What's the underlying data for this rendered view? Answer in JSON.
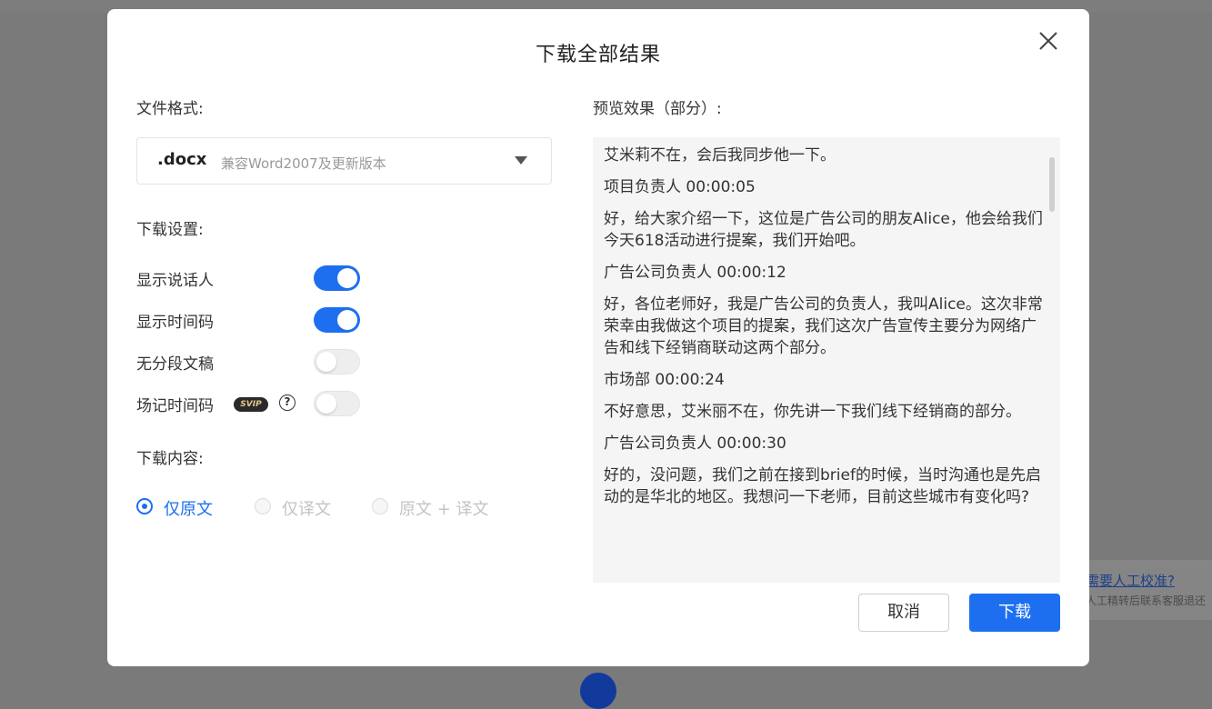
{
  "background": {
    "hint_title": "需要人工校准?",
    "hint_subtitle": "人工精转后联系客服退还"
  },
  "modal": {
    "title": "下载全部结果",
    "file_format_label": "文件格式:",
    "format_select": {
      "value": ".docx",
      "description": "兼容Word2007及更新版本"
    },
    "download_settings_label": "下载设置:",
    "toggles": [
      {
        "label": "显示说话人",
        "on": true
      },
      {
        "label": "显示时间码",
        "on": true
      },
      {
        "label": "无分段文稿",
        "on": false
      },
      {
        "label": "场记时间码",
        "on": false
      }
    ],
    "svip_badge": "SVIP",
    "help_icon": "?",
    "download_content_label": "下载内容:",
    "content_options": [
      {
        "label": "仅原文",
        "checked": true
      },
      {
        "label": "仅译文",
        "checked": false
      },
      {
        "label": "原文 + 译文",
        "checked": false
      }
    ],
    "preview_label": "预览效果（部分）:",
    "preview": [
      {
        "type": "text",
        "content": "艾米莉不在，会后我同步他一下。"
      },
      {
        "type": "speaker",
        "content": "项目负责人  00:00:05"
      },
      {
        "type": "text",
        "content": "好，给大家介绍一下，这位是广告公司的朋友Alice，他会给我们今天618活动进行提案，我们开始吧。"
      },
      {
        "type": "speaker",
        "content": "广告公司负责人  00:00:12"
      },
      {
        "type": "text",
        "content": "好，各位老师好，我是广告公司的负责人，我叫Alice。这次非常荣幸由我做这个项目的提案，我们这次广告宣传主要分为网络广告和线下经销商联动这两个部分。"
      },
      {
        "type": "speaker",
        "content": "市场部  00:00:24"
      },
      {
        "type": "text",
        "content": "不好意思，艾米丽不在，你先讲一下我们线下经销商的部分。"
      },
      {
        "type": "speaker",
        "content": "广告公司负责人  00:00:30"
      },
      {
        "type": "text",
        "content": "好的，没问题，我们之前在接到brief的时候，当时沟通也是先启动的是华北的地区。我想问一下老师，目前这些城市有变化吗?"
      }
    ],
    "cancel_label": "取消",
    "download_label": "下载"
  },
  "colors": {
    "accent": "#1e6ff0",
    "overlay": "#7a7a7a"
  }
}
